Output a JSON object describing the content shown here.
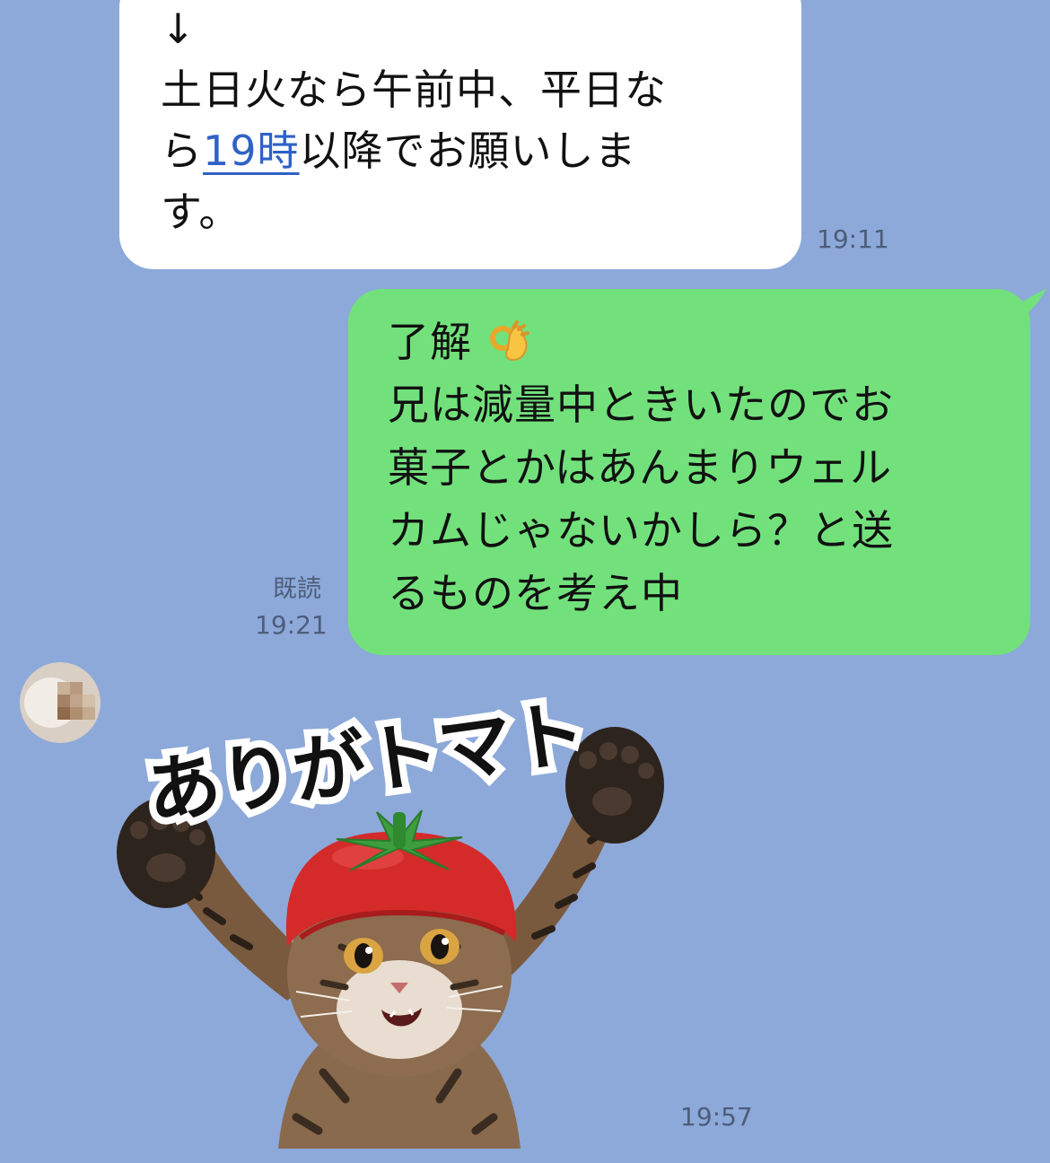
{
  "messages": {
    "received_1": {
      "lines": [
        "↓",
        "土日火なら午前中、平日な",
        "ら",
        "19時",
        "以降でお願いしま",
        "す。"
      ],
      "time": "19:11"
    },
    "sent_1": {
      "lines": [
        "了解",
        "兄は減量中ときいたのでお",
        "菓子とかはあんまりウェル",
        "カムじゃないかしら？と送",
        "るものを考え中"
      ],
      "emoji": "ok-hand",
      "read_label": "既読",
      "time": "19:21"
    },
    "received_sticker": {
      "caption": "ありがトマト",
      "time": "19:57"
    }
  },
  "colors": {
    "background": "#8da9d9",
    "sent_bubble": "#72e17c",
    "received_bubble": "#ffffff",
    "link": "#2f62c6",
    "timestamp": "#4d5d7a"
  }
}
